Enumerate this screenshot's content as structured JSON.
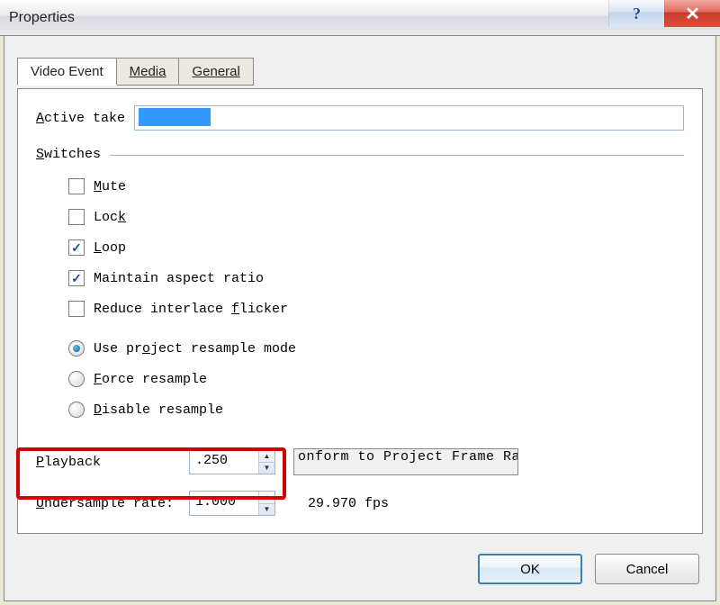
{
  "window": {
    "title": "Properties"
  },
  "tabs": {
    "video_event": "Video Event",
    "media": "Media",
    "general": "General"
  },
  "labels": {
    "active_take_pre": "A",
    "active_take_post": "ctive take",
    "switches_pre": "S",
    "switches_post": "witches",
    "mute_pre": "M",
    "mute_post": "ute",
    "lock_pre1": "L",
    "lock_mid": "oc",
    "lock_post": "k",
    "loop_pre": "L",
    "loop_post": "oop",
    "maintain": "Maintain aspect ratio",
    "reduce_pre": "Reduce interlace ",
    "reduce_ul": "f",
    "reduce_post": "licker",
    "use_pre": "Use pr",
    "use_ul": "o",
    "use_post": "ject resample mode",
    "force_post": "orce resample",
    "disable_ul": "D",
    "disable_post": "isable resample",
    "playback_ul": "P",
    "playback_post": "layback",
    "undersample_ul": "U",
    "undersample_post": "ndersample rate:",
    "conform": "onform to Project Frame Rat",
    "fps": "29.970 fps"
  },
  "values": {
    "playback": ".250",
    "undersample": "1.000"
  },
  "buttons": {
    "ok": "OK",
    "cancel": "Cancel"
  }
}
